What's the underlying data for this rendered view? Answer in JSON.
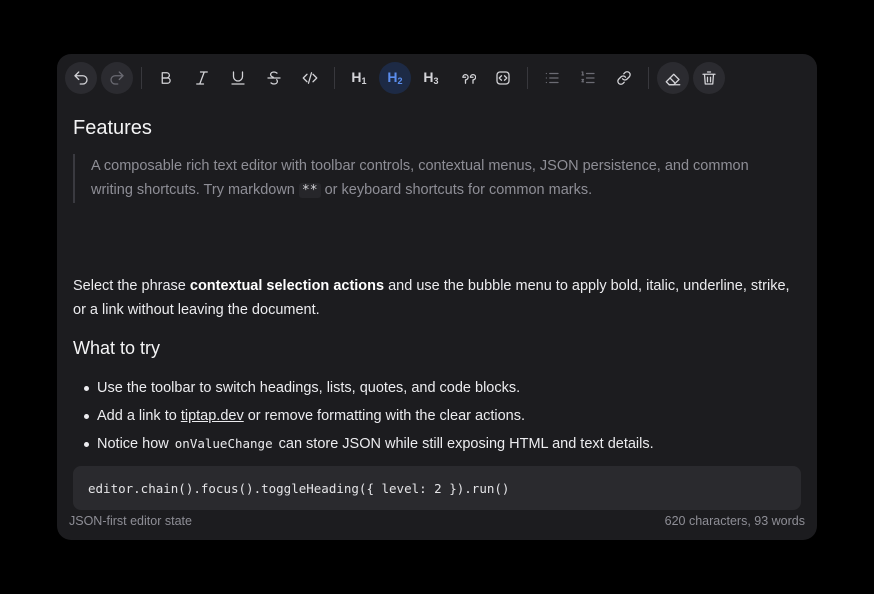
{
  "toolbar": {
    "buttons": [
      {
        "name": "undo-icon",
        "label": "Undo"
      },
      {
        "name": "redo-icon",
        "label": "Redo"
      },
      {
        "name": "bold-icon",
        "label": "Bold"
      },
      {
        "name": "italic-icon",
        "label": "Italic"
      },
      {
        "name": "underline-icon",
        "label": "Underline"
      },
      {
        "name": "strikethrough-icon",
        "label": "Strikethrough"
      },
      {
        "name": "code-icon",
        "label": "Inline code"
      },
      {
        "name": "heading-1-icon",
        "label": "Heading 1"
      },
      {
        "name": "heading-2-icon",
        "label": "Heading 2",
        "active": true
      },
      {
        "name": "heading-3-icon",
        "label": "Heading 3"
      },
      {
        "name": "quote-icon",
        "label": "Blockquote"
      },
      {
        "name": "code-block-icon",
        "label": "Code block"
      },
      {
        "name": "bullet-list-icon",
        "label": "Bullet list"
      },
      {
        "name": "ordered-list-icon",
        "label": "Ordered list"
      },
      {
        "name": "link-icon",
        "label": "Link"
      },
      {
        "name": "eraser-icon",
        "label": "Clear formatting"
      },
      {
        "name": "trash-icon",
        "label": "Clear content"
      }
    ],
    "accent_color": "#5a8dee"
  },
  "document": {
    "heading1": "Features",
    "quote": {
      "part1": "A composable rich text editor with toolbar controls, contextual menus, JSON persistence, and common writing shortcuts. Try markdown ",
      "code": "**",
      "part2": " or keyboard shortcuts for common marks."
    },
    "paragraph": {
      "part1": "Select the phrase ",
      "bold": "contextual selection actions",
      "part2": " and use the bubble menu to apply bold, italic, underline, strike, or a link without leaving the document."
    },
    "heading2": "What to try",
    "list": {
      "item1": "Use the toolbar to switch headings, lists, quotes, and code blocks.",
      "item2_before": "Add a link to ",
      "item2_link": "tiptap.dev",
      "item2_after": " or remove formatting with the clear actions.",
      "item3_before": "Notice how ",
      "item3_code": "onValueChange",
      "item3_after": " can store JSON while still exposing HTML and text details."
    },
    "code_block": "editor.chain().focus().toggleHeading({ level: 2 }).run()"
  },
  "footer": {
    "left": "JSON-first editor state",
    "right": "620 characters, 93 words"
  }
}
